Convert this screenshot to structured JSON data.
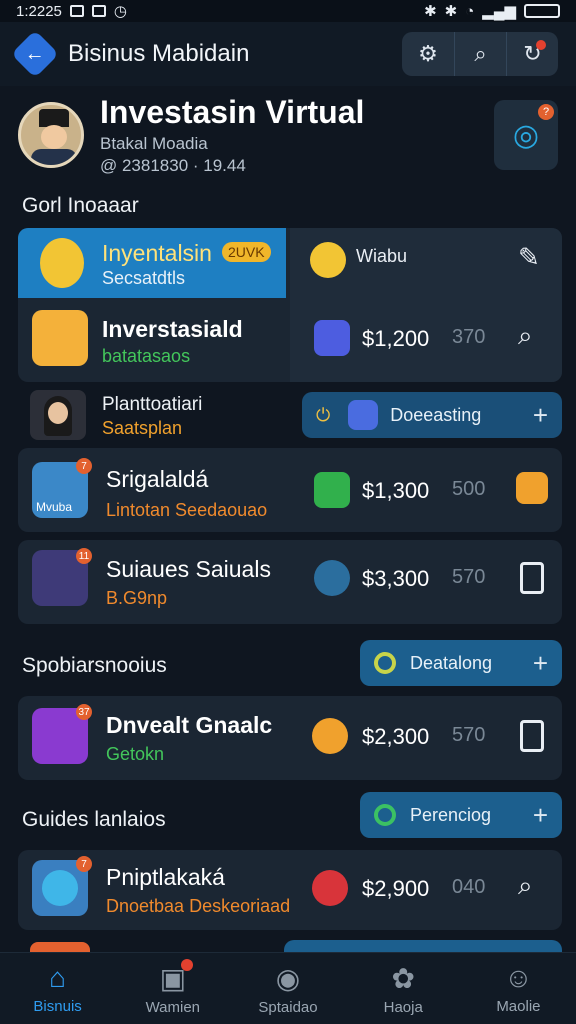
{
  "status_bar": {
    "time": "1:2225",
    "icons": [
      "image-icon",
      "chart-icon",
      "clock-icon"
    ],
    "right_icons": [
      "bluetooth-icon",
      "bluetooth-icon",
      "alarm-icon",
      "wifi-icon",
      "signal-icon",
      "battery-icon"
    ]
  },
  "app_bar": {
    "title": "Bisinus Mabidain",
    "actions": [
      "gear-icon",
      "search-icon",
      "refresh-icon"
    ]
  },
  "profile": {
    "name": "Investasin Virtual",
    "subtitle": "Btakal Moadia",
    "time": "@ 2381830 · 19.44"
  },
  "sections": {
    "first": "Gorl Inoaaar",
    "second": "Spobiarsnooius",
    "third": "Guides lanlaios"
  },
  "featured": {
    "title": "Inyentalsin",
    "tag": "2UVK",
    "sub": "Secsatdtls",
    "right_label": "Wiabu"
  },
  "items": [
    {
      "title": "Inverstasiald",
      "sub": "batatasaos",
      "price": "$1,200",
      "price_small": "370"
    },
    {
      "title": "Planttoatiari",
      "sub": "Saatsplan",
      "button": "Doeeasting"
    },
    {
      "title": "Srigalaldá",
      "sub": "Lintotan Seedaouao",
      "price": "$1,300",
      "price_small": "500"
    },
    {
      "title": "Suiaues Saiuals",
      "sub": "B.G9np",
      "price": "$3,300",
      "price_small": "570"
    },
    {
      "title": "Dnvealt Gnaalc",
      "sub": "Getokn",
      "price": "$2,300",
      "price_small": "570"
    },
    {
      "title": "Pniptlakaká",
      "sub": "Dnoetbaa Deskeoriaad",
      "price": "$2,900",
      "price_small": "040"
    }
  ],
  "section_buttons": {
    "second": "Deatalong",
    "third": "Perenciog"
  },
  "tile_labels": {
    "srigal": "Mvuba"
  },
  "badges": {
    "n1": "7",
    "n2": "11",
    "n3": "37",
    "n4": "7"
  },
  "bottom_nav": [
    {
      "label": "Bisnuis",
      "icon": "home-icon"
    },
    {
      "label": "Wamien",
      "icon": "search-screen-icon"
    },
    {
      "label": "Sptaidao",
      "icon": "chart-icon"
    },
    {
      "label": "Haoja",
      "icon": "puzzle-icon"
    },
    {
      "label": "Maolie",
      "icon": "profile-icon"
    }
  ],
  "colors": {
    "accent": "#2f9cf0",
    "featured_bg": "#1e7fc2",
    "button_bg": "#1c5f8e",
    "green": "#3bc163",
    "orange": "#f08a2d"
  }
}
